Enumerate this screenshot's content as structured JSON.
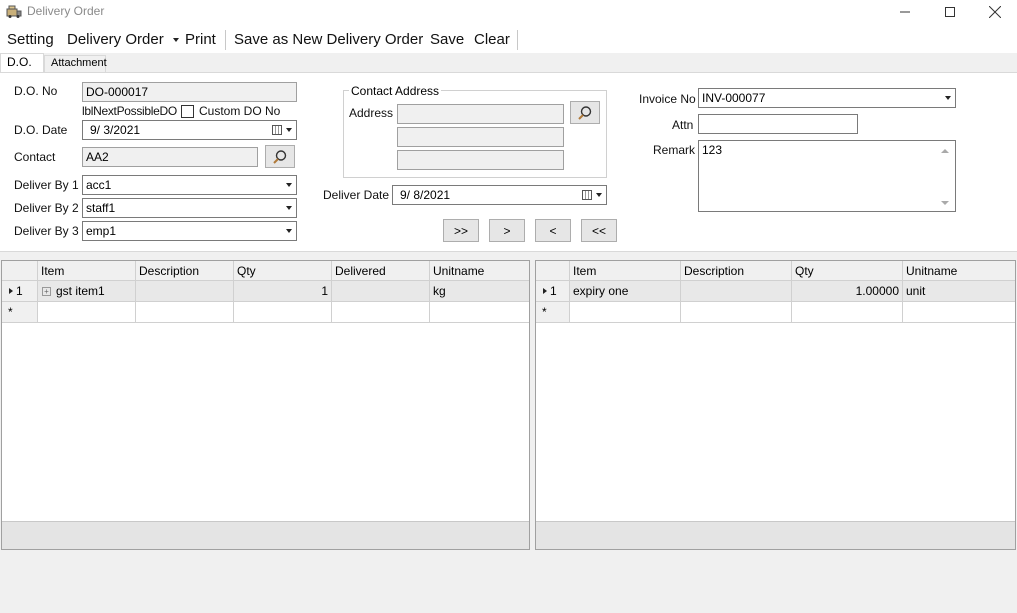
{
  "window": {
    "title": "Delivery Order"
  },
  "menu": {
    "setting": "Setting",
    "delivery_order": "Delivery Order",
    "print": "Print",
    "save_as_new": "Save as New Delivery Order",
    "save": "Save",
    "clear": "Clear"
  },
  "tabs": [
    {
      "label": "D.O."
    },
    {
      "label": "Attachment"
    }
  ],
  "form": {
    "do_no_label": "D.O. No",
    "do_no_value": "DO-000017",
    "next_possible_label": "lblNextPossibleDO",
    "custom_do_label": "Custom DO No",
    "do_date_label": "D.O. Date",
    "do_date_value": "9/  3/2021",
    "contact_label": "Contact",
    "contact_value": "AA2",
    "deliver_by1_label": "Deliver By 1",
    "deliver_by1_value": "acc1",
    "deliver_by2_label": "Deliver By 2",
    "deliver_by2_value": "staff1",
    "deliver_by3_label": "Deliver By 3",
    "deliver_by3_value": "emp1",
    "contact_address_title": "Contact Address",
    "address_label": "Address",
    "address_line1": "",
    "address_line2": "",
    "address_line3": "",
    "deliver_date_label": "Deliver Date",
    "deliver_date_value": "9/  8/2021",
    "invoice_label": "Invoice No",
    "invoice_value": "INV-000077",
    "attn_label": "Attn",
    "attn_value": "",
    "remark_label": "Remark",
    "remark_value": "123"
  },
  "nav": {
    "last": ">>",
    "next": ">",
    "prev": "<",
    "first": "<<"
  },
  "left_grid": {
    "columns": [
      "Item",
      "Description",
      "Qty",
      "Delivered",
      "Unitname"
    ],
    "rows": [
      {
        "num": "1",
        "item": "gst item1",
        "description": "",
        "qty": "1",
        "delivered": "",
        "unitname": "kg"
      }
    ],
    "new_row_marker": "*"
  },
  "right_grid": {
    "columns": [
      "Item",
      "Description",
      "Qty",
      "Unitname"
    ],
    "rows": [
      {
        "num": "1",
        "item": "expiry one",
        "description": "",
        "qty": "1.00000",
        "unitname": "unit"
      }
    ],
    "new_row_marker": "*"
  }
}
